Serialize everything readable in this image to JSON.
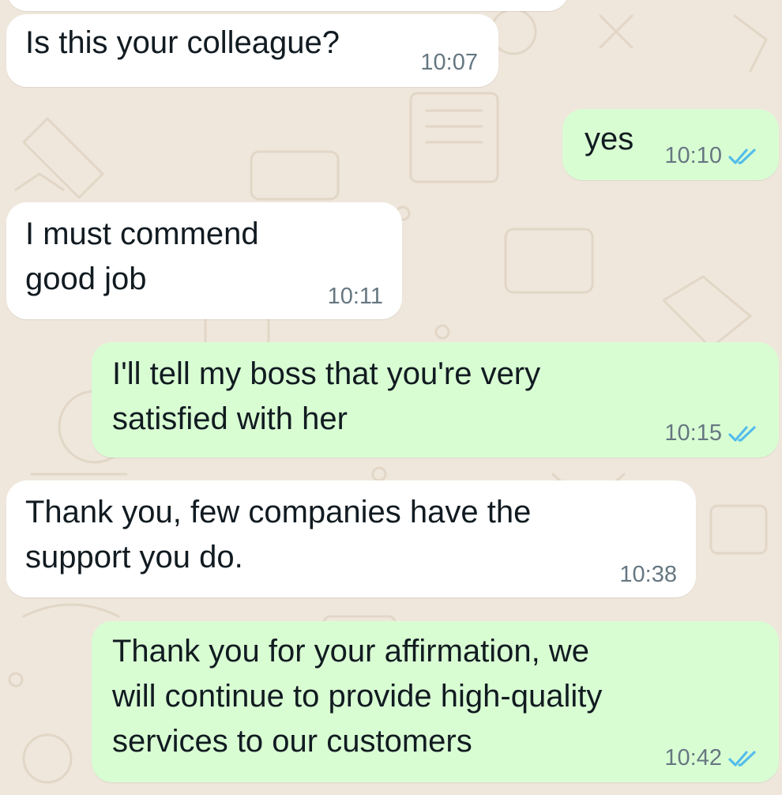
{
  "chat": {
    "messages": [
      {
        "direction": "incoming",
        "text": "Is this your colleague?",
        "time": "10:07"
      },
      {
        "direction": "outgoing",
        "text": "yes",
        "time": "10:10",
        "status": "read",
        "status_icon": "double-check-icon"
      },
      {
        "direction": "incoming",
        "text": "I must commend\ngood job",
        "time": "10:11"
      },
      {
        "direction": "outgoing",
        "text": "I'll tell my boss that you're very\nsatisfied with her",
        "time": "10:15",
        "status": "read",
        "status_icon": "double-check-icon"
      },
      {
        "direction": "incoming",
        "text": "Thank you, few companies have the\nsupport you do.",
        "time": "10:38"
      },
      {
        "direction": "outgoing",
        "text": "Thank you for your affirmation, we\nwill continue to provide high-quality\nservices to our customers",
        "time": "10:42",
        "status": "read",
        "status_icon": "double-check-icon"
      }
    ]
  },
  "colors": {
    "wallpaper": "#efe7dc",
    "incoming_bubble": "#ffffff",
    "outgoing_bubble": "#d9fdd3",
    "read_ticks": "#53bdeb",
    "timestamp": "#667781"
  }
}
